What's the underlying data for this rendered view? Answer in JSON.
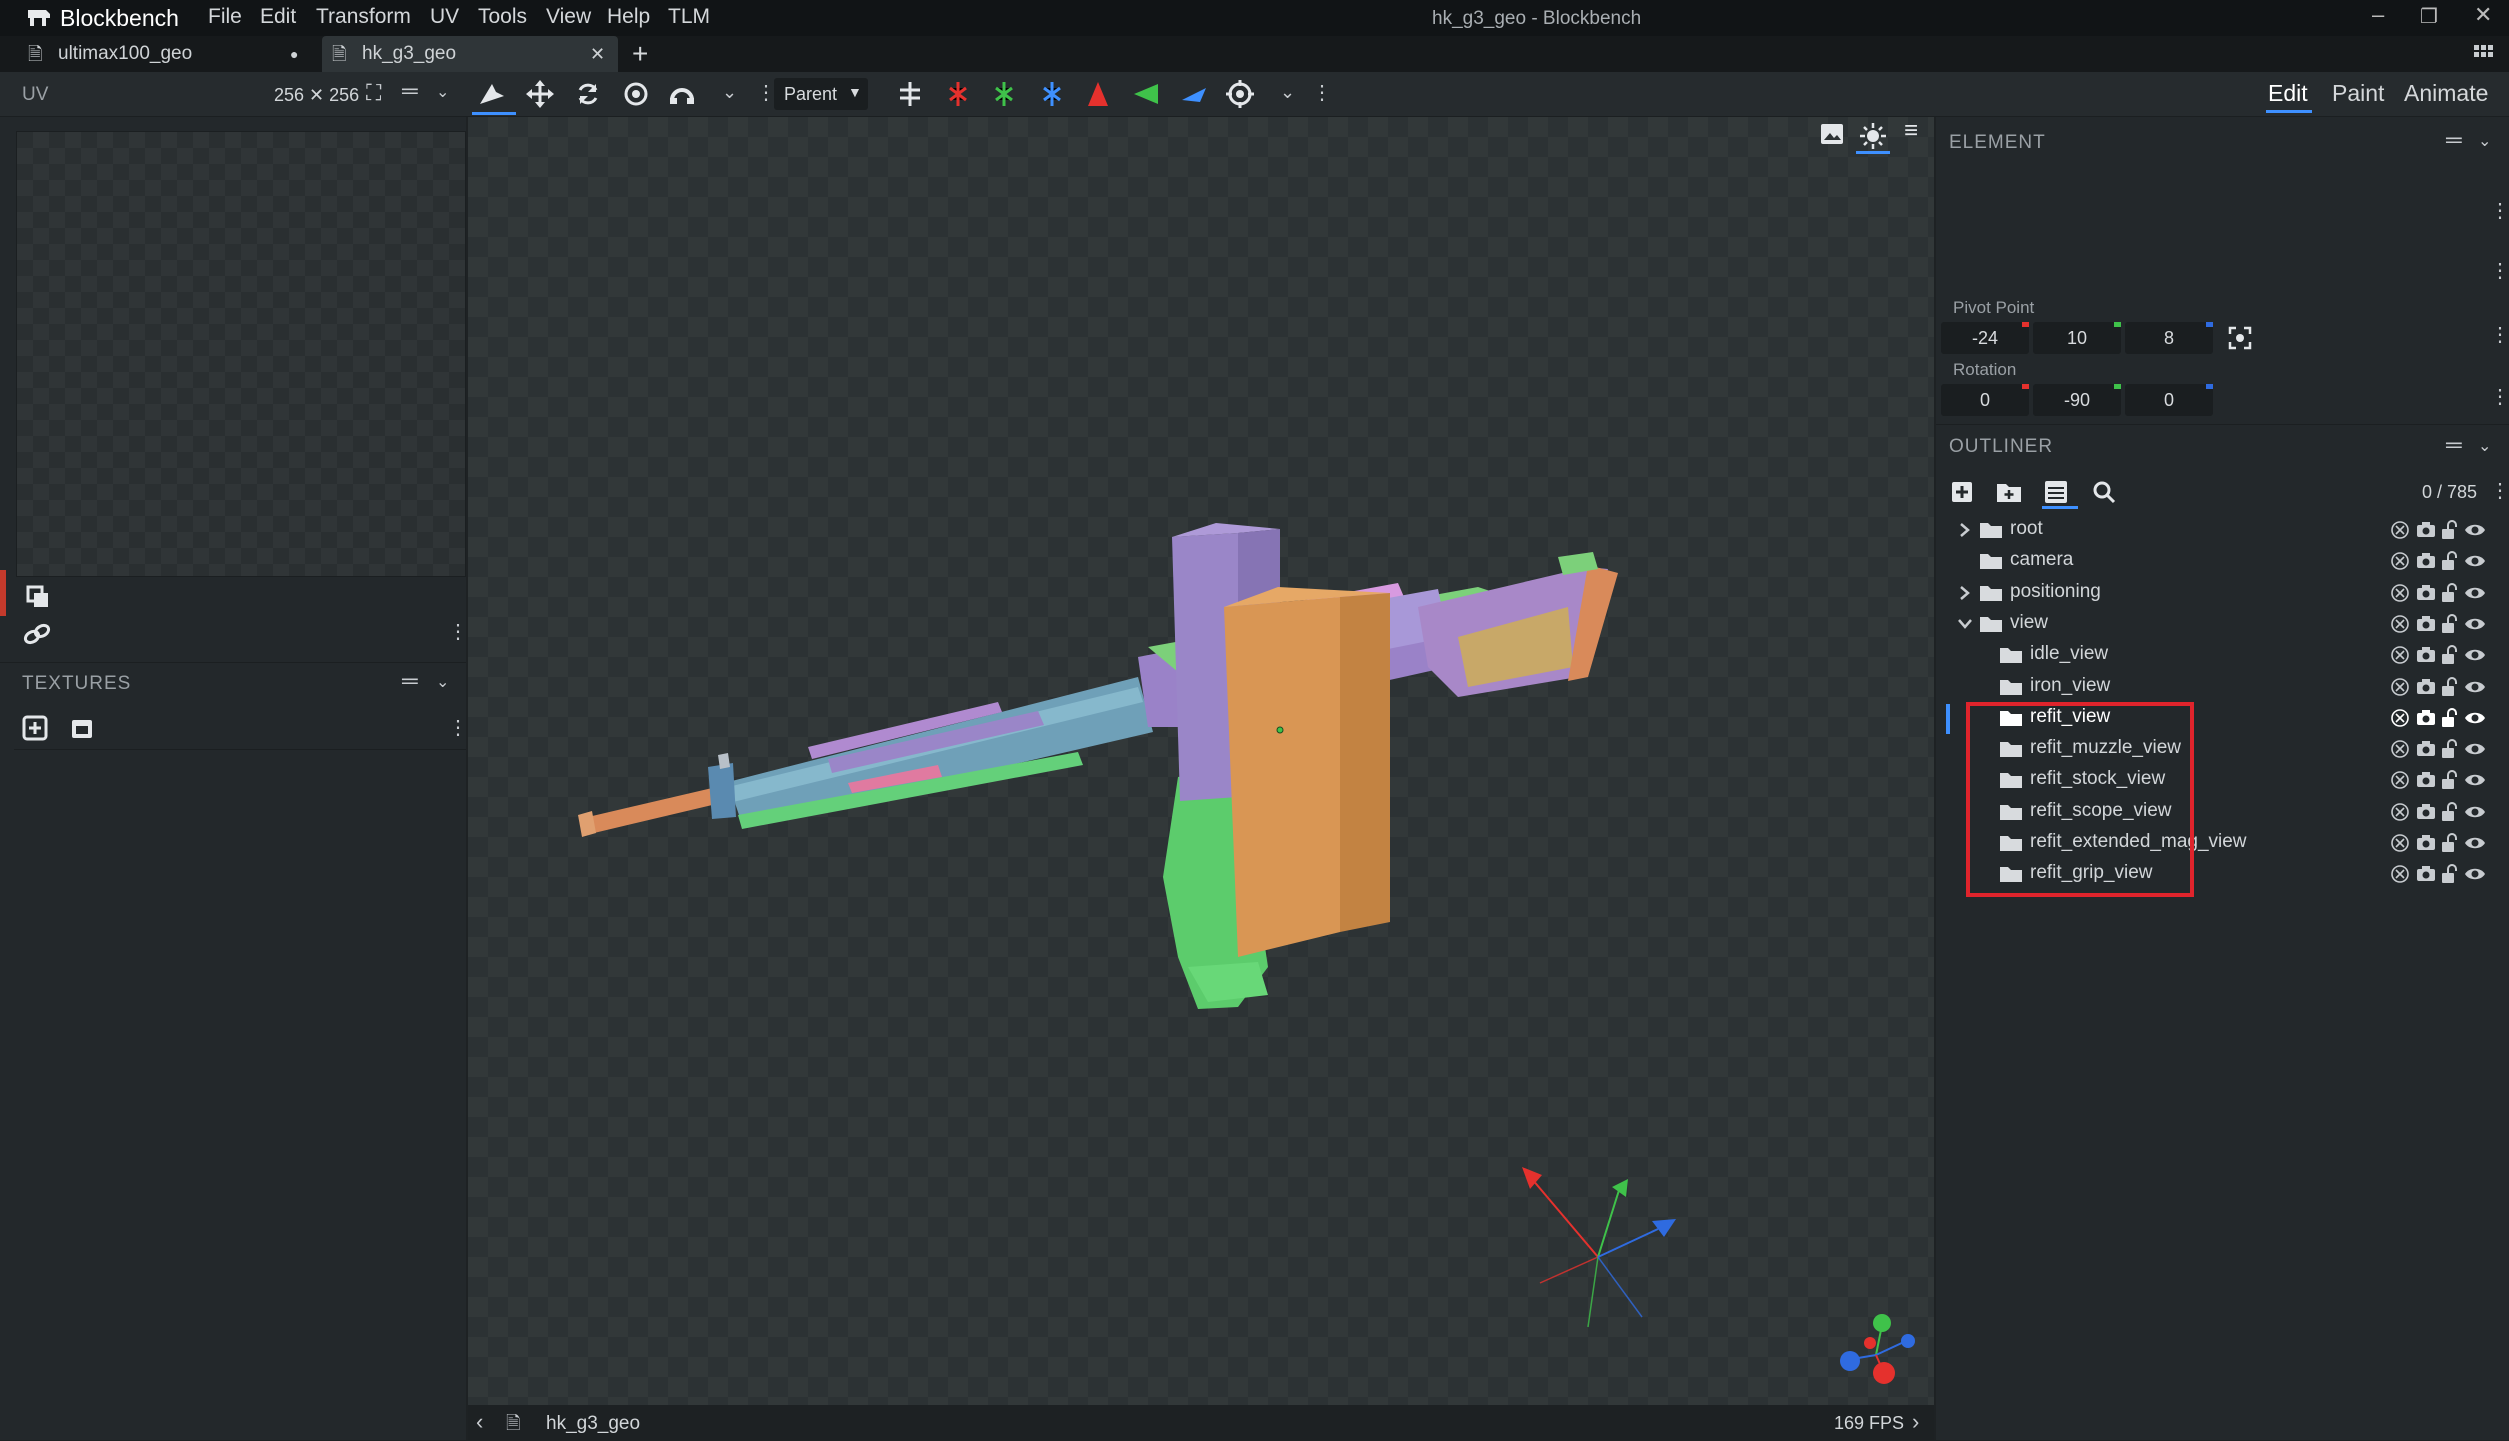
{
  "app": {
    "name": "Blockbench",
    "window_title": "hk_g3_geo - Blockbench"
  },
  "menu": [
    "File",
    "Edit",
    "Transform",
    "UV",
    "Tools",
    "View",
    "Help",
    "TLM"
  ],
  "tabs": [
    {
      "label": "ultimax100_geo",
      "unsaved": "●"
    },
    {
      "label": "hk_g3_geo",
      "close": "✕",
      "active": true
    }
  ],
  "toolbar": {
    "pivot_mode": "Parent"
  },
  "modes": {
    "edit": "Edit",
    "paint": "Paint",
    "animate": "Animate"
  },
  "uv_panel": {
    "title": "UV",
    "size": "256 ✕ 256"
  },
  "textures_panel": {
    "title": "TEXTURES"
  },
  "element_panel": {
    "title": "ELEMENT",
    "pivot_label": "Pivot Point",
    "pivot": [
      "-24",
      "10",
      "8"
    ],
    "rotation_label": "Rotation",
    "rotation": [
      "0",
      "-90",
      "0"
    ]
  },
  "outliner": {
    "title": "OUTLINER",
    "count": "0 / 785",
    "items": [
      {
        "label": "root",
        "depth": 0,
        "arrow": "right"
      },
      {
        "label": "camera",
        "depth": 0,
        "arrow": "none"
      },
      {
        "label": "positioning",
        "depth": 0,
        "arrow": "right"
      },
      {
        "label": "view",
        "depth": 0,
        "arrow": "down"
      },
      {
        "label": "idle_view",
        "depth": 1
      },
      {
        "label": "iron_view",
        "depth": 1
      },
      {
        "label": "refit_view",
        "depth": 1,
        "selected": true
      },
      {
        "label": "refit_muzzle_view",
        "depth": 1
      },
      {
        "label": "refit_stock_view",
        "depth": 1
      },
      {
        "label": "refit_scope_view",
        "depth": 1
      },
      {
        "label": "refit_extended_mag_view",
        "depth": 1
      },
      {
        "label": "refit_grip_view",
        "depth": 1
      }
    ]
  },
  "viewport": {
    "model_name": "hk_g3_geo",
    "fps": "169 FPS"
  },
  "colors": {
    "accent": "#3e90ff",
    "highlight_box": "#e0242c",
    "axis_x": "#e5312d",
    "axis_y": "#3fc24a",
    "axis_z": "#2f6be0"
  }
}
